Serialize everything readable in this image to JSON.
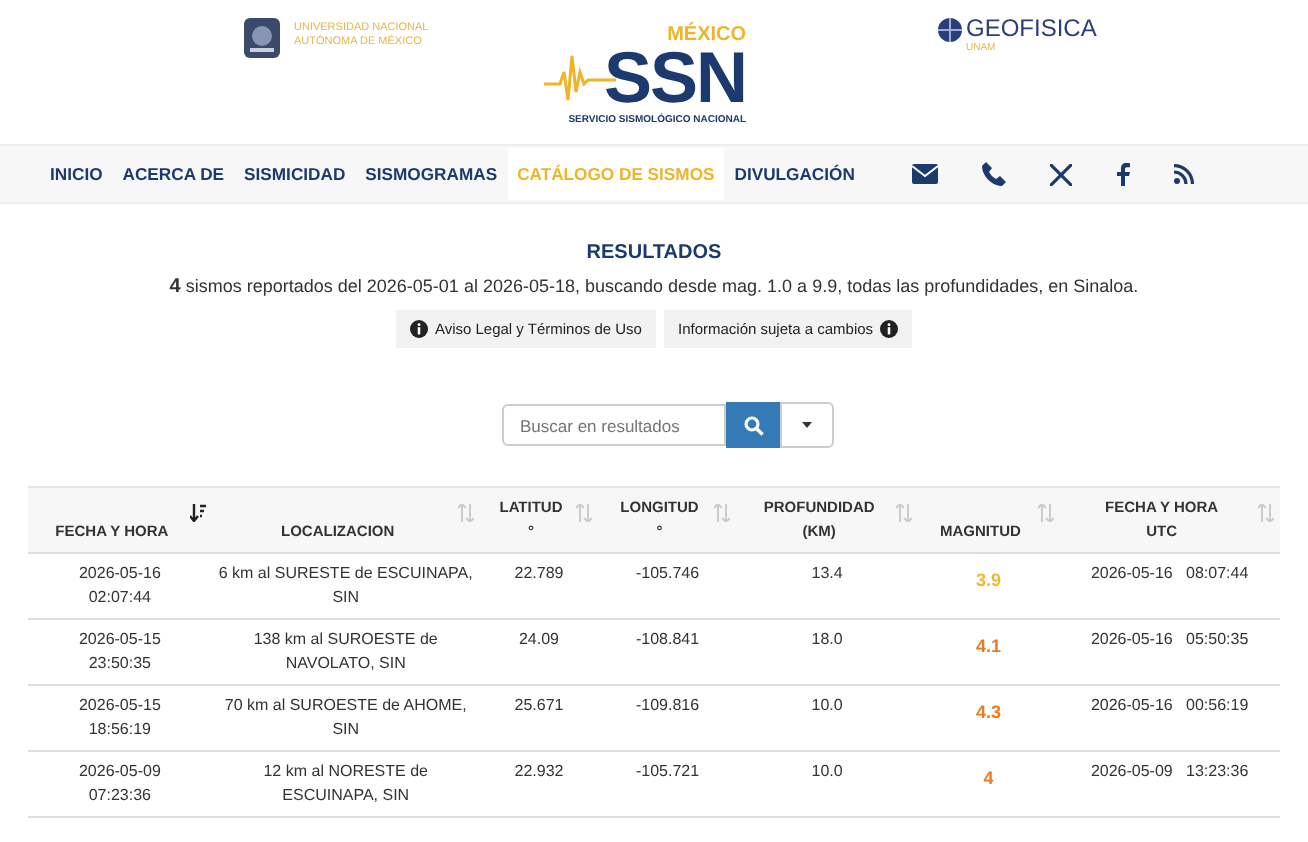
{
  "header": {
    "unam_lines": [
      "UNIVERSIDAD NACIONAL",
      "AUTÓNOMA DE MÉXICO"
    ],
    "ssn": {
      "country": "MÉXICO",
      "acronym": "SSN",
      "name": "SERVICIO SISMOLÓGICO NACIONAL"
    },
    "geofisica": {
      "name": "GEOFISICA",
      "sub": "UNAM"
    }
  },
  "nav": {
    "items": [
      {
        "label": "INICIO",
        "selected": false
      },
      {
        "label": "ACERCA DE",
        "selected": false
      },
      {
        "label": "SISMICIDAD",
        "selected": false
      },
      {
        "label": "SISMOGRAMAS",
        "selected": false
      },
      {
        "label": "CATÁLOGO DE SISMOS",
        "selected": true
      },
      {
        "label": "DIVULGACIÓN",
        "selected": false
      }
    ],
    "icons": [
      {
        "kind": "mail"
      },
      {
        "kind": "phone"
      },
      {
        "kind": "x"
      },
      {
        "kind": "facebook"
      },
      {
        "kind": "rss"
      }
    ]
  },
  "results": {
    "title": "RESULTADOS",
    "summary": "**4**  sismos reportados del 2026-05-01 al 2026-05-18, buscando desde mag. 1.0 a 9.9, todas las profundidades, en Sinaloa.",
    "buttons": [
      {
        "label": "Aviso Legal y Términos de Uso",
        "icon_first": true
      },
      {
        "label": "Información sujeta a cambios",
        "icon_first": false
      }
    ]
  },
  "search": {
    "placeholder": "Buscar en resultados"
  },
  "table": {
    "columns": [
      {
        "lines": [
          "FECHA Y HORA"
        ],
        "sorted": true
      },
      {
        "lines": [
          "LOCALIZACION"
        ],
        "sorted": false
      },
      {
        "lines": [
          "LATITUD",
          "°"
        ],
        "sorted": false
      },
      {
        "lines": [
          "LONGITUD",
          "°"
        ],
        "sorted": false
      },
      {
        "lines": [
          "PROFUNDIDAD",
          "(KM)"
        ],
        "sorted": false
      },
      {
        "lines": [
          "MAGNITUD"
        ],
        "sorted": false
      },
      {
        "lines": [
          "FECHA Y HORA",
          "UTC"
        ],
        "sorted": false
      }
    ],
    "rows": [
      {
        "date": "2026-05-16",
        "time": "02:07:44",
        "location": "6 km al SURESTE de ESCUINAPA, SIN",
        "lat": "22.789",
        "lon": "-105.746",
        "depth": "13.4",
        "mag": "3.9",
        "color": "#f2b92c",
        "utc_date": "2026-05-16",
        "utc_time": "08:07:44"
      },
      {
        "date": "2026-05-15",
        "time": "23:50:35",
        "location": "138 km al SUROESTE de NAVOLATO, SIN",
        "lat": "24.09",
        "lon": "-108.841",
        "depth": "18.0",
        "mag": "4.1",
        "color": "#ec7a22",
        "utc_date": "2026-05-16",
        "utc_time": "05:50:35"
      },
      {
        "date": "2026-05-15",
        "time": "18:56:19",
        "location": "70 km al SUROESTE de AHOME, SIN",
        "lat": "25.671",
        "lon": "-109.816",
        "depth": "10.0",
        "mag": "4.3",
        "color": "#ec7a22",
        "utc_date": "2026-05-16",
        "utc_time": "00:56:19"
      },
      {
        "date": "2026-05-09",
        "time": "07:23:36",
        "location": "12 km al NORESTE de ESCUINAPA, SIN",
        "lat": "22.932",
        "lon": "-105.721",
        "depth": "10.0",
        "mag": "4",
        "color": "#ec7a22",
        "utc_date": "2026-05-09",
        "utc_time": "13:23:36"
      }
    ]
  }
}
